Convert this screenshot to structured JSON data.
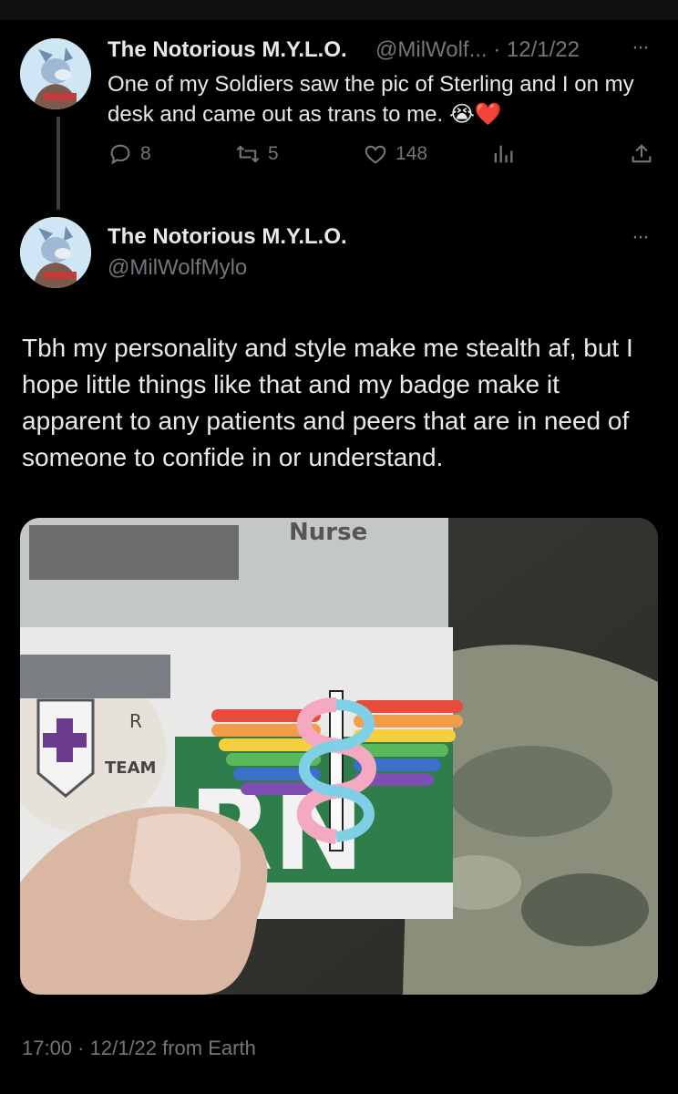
{
  "status_bar": {},
  "quoted_tweet": {
    "display_name": "The Notorious M.Y.L.O.",
    "handle_date": "@MilWolf... · 12/1/22",
    "text": "One of my Soldiers saw the pic of Sterling and I on my desk and came out as trans to me. 😭❤️",
    "emoji": "😭❤️",
    "replies": "8",
    "retweets": "5",
    "likes": "148",
    "more": "···"
  },
  "main_tweet": {
    "display_name": "The Notorious M.Y.L.O.",
    "handle": "@MilWolfMylo",
    "more": "···",
    "text": "Tbh my personality and style make me stealth af, but I hope little things like that and my badge make it apparent to any patients and peers that are in need of someone to confide in or understand.",
    "image": {
      "badge_text": "Nurse",
      "pin_text": "TEAM",
      "badge_letters": "RN",
      "pin_letter": "R"
    },
    "footer": "17:00 · 12/1/22 from Earth"
  },
  "colors": {
    "background": "#000000",
    "text": "#e7e9ea",
    "muted": "#71767b",
    "thread_line": "#3a3f43"
  },
  "icons": [
    "reply-icon",
    "retweet-icon",
    "like-icon",
    "views-icon",
    "share-icon",
    "more-icon"
  ]
}
